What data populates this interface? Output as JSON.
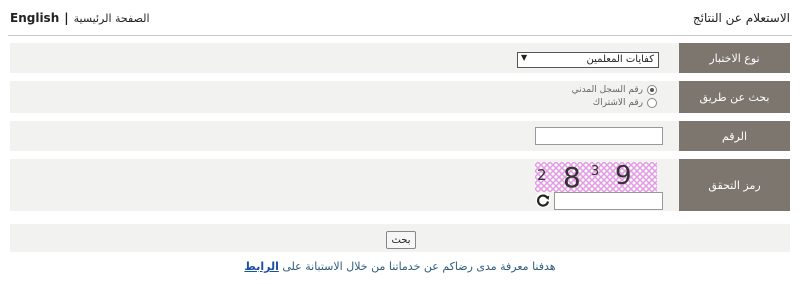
{
  "header": {
    "title": "الاستعلام عن النتائج",
    "nav_english": "English",
    "nav_separator": "|",
    "nav_home": "الصفحة الرئيسية"
  },
  "form": {
    "test_type": {
      "label": "نوع الاختبار",
      "selected": "كفايات المعلمين"
    },
    "search_by": {
      "label": "بحث عن طريق",
      "options": [
        {
          "label": "رقم السجل المدني",
          "checked": true
        },
        {
          "label": "رقم الاشتراك",
          "checked": false
        }
      ]
    },
    "number": {
      "label": "الرقم",
      "value": ""
    },
    "captcha": {
      "label": "رمز التحقق",
      "chars": [
        "2",
        "8",
        "3",
        "9"
      ],
      "value": ""
    },
    "submit_label": "بحث"
  },
  "footer": {
    "text": "هدفنا معرفة مدى رضاكم عن خدماتنا من خلال الاستبانة على",
    "link_label": "الرابط"
  },
  "colors": {
    "label_bg": "#7c766f",
    "row_bg": "#f2f2f0",
    "captcha_bg": "#e39be3",
    "link": "#1a4fa3"
  }
}
